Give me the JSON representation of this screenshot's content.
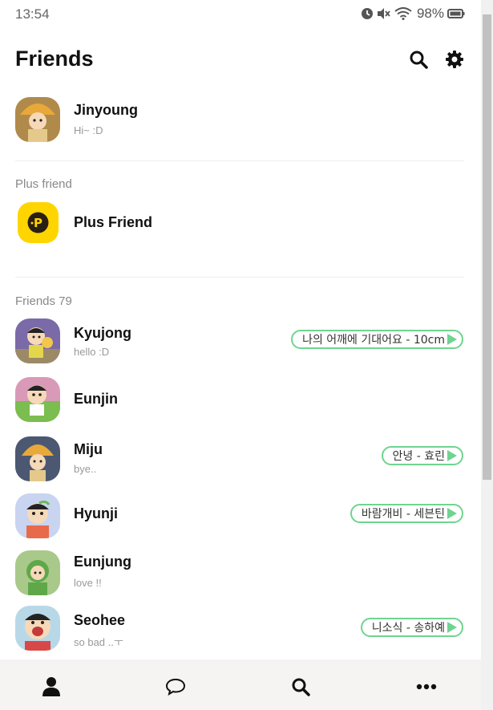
{
  "status_bar": {
    "time": "13:54",
    "battery": "98%"
  },
  "header": {
    "title": "Friends"
  },
  "me": {
    "name": "Jinyoung",
    "status": "Hi~ :D"
  },
  "plus_section": {
    "label": "Plus friend",
    "item": {
      "name": "Plus Friend"
    }
  },
  "friends_section": {
    "label": "Friends 79"
  },
  "friends": [
    {
      "name": "Kyujong",
      "status": "hello :D",
      "music": "나의 어깨에 기대어요 - 10cm"
    },
    {
      "name": "Eunjin",
      "status": "",
      "music": ""
    },
    {
      "name": "Miju",
      "status": "bye..",
      "music": "안녕 - 효린"
    },
    {
      "name": "Hyunji",
      "status": "",
      "music": "바람개비 - 세븐틴"
    },
    {
      "name": "Eunjung",
      "status": "love !!",
      "music": ""
    },
    {
      "name": "Seohee",
      "status": "so bad ..ㅜ",
      "music": "니소식 - 송하예"
    }
  ],
  "tabs": [
    "friends",
    "chats",
    "find",
    "more"
  ],
  "colors": {
    "accent_green": "#6fd48f",
    "plus_yellow": "#ffd500",
    "tab_bg": "#f6f3f3"
  }
}
